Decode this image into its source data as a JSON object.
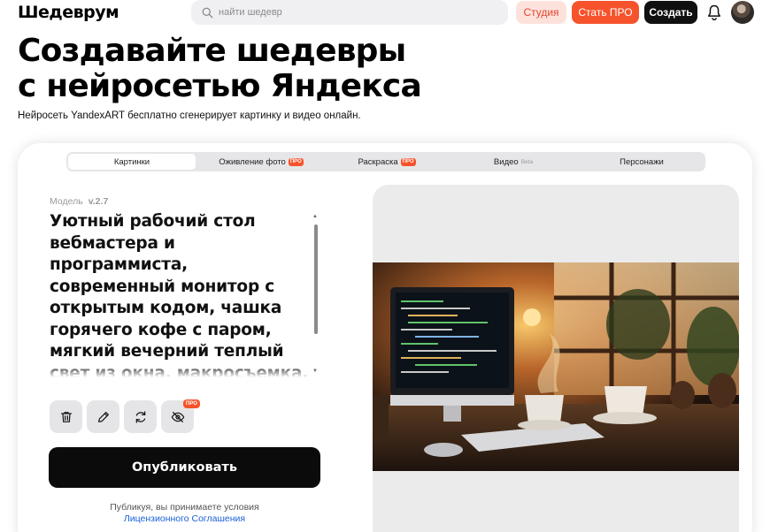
{
  "header": {
    "logo": "Шедеврум",
    "search_placeholder": "найти шедевр",
    "studio_label": "Студия",
    "pro_label": "Стать ПРО",
    "create_label": "Создать"
  },
  "hero": {
    "title_line1": "Создавайте шедевры",
    "title_line2": "с нейросетью Яндекса",
    "subtitle": "Нейросеть YandexART бесплатно сгенерирует картинку и видео онлайн."
  },
  "tabs": [
    {
      "label": "Картинки",
      "active": true
    },
    {
      "label": "Оживление фото",
      "badge": "ПРО"
    },
    {
      "label": "Раскраска",
      "badge": "ПРО"
    },
    {
      "label": "Видео",
      "note": "Beta"
    },
    {
      "label": "Персонажи"
    }
  ],
  "generator": {
    "model_label": "Модель",
    "model_version": "v.2.7",
    "prompt": "Уютный рабочий стол вебмастера и программиста, современный монитор с открытым кодом, чашка горячего кофе с паром, мягкий вечерний теплый свет из окна, макросъемка, кинематографичный свет",
    "pro_tag": "ПРО",
    "publish_label": "Опубликовать",
    "terms_text": "Публикуя, вы принимаете условия",
    "terms_link": "Лицензионного Соглашения"
  },
  "icons": [
    "search-icon",
    "bell-icon",
    "trash-icon",
    "pencil-icon",
    "refresh-icon",
    "eye-off-icon"
  ],
  "colors": {
    "accent": "#f6532c",
    "accent_light": "#fde2dc",
    "dark": "#0b0b0b",
    "link": "#1a5fd6"
  }
}
